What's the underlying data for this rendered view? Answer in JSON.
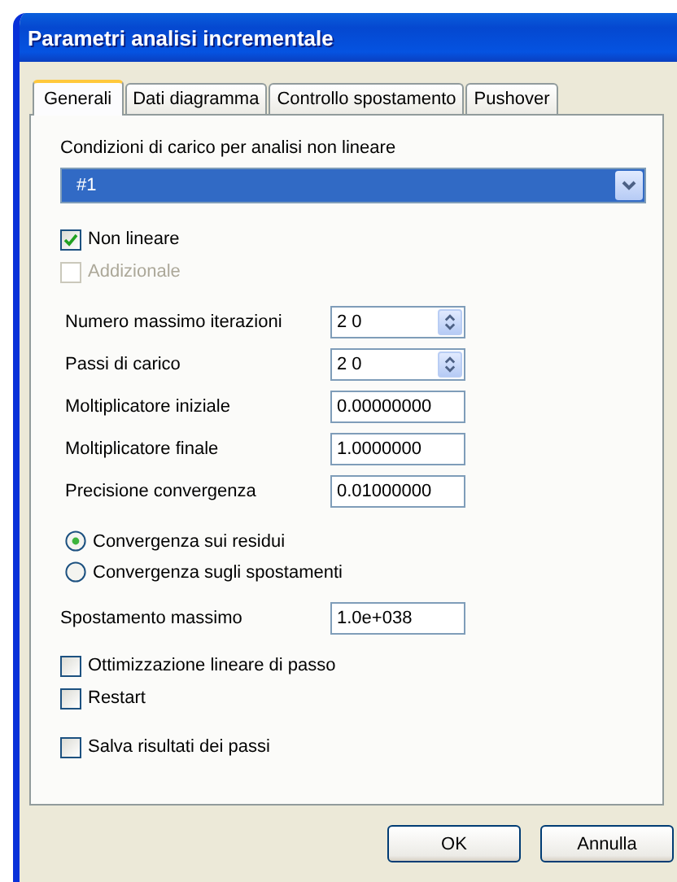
{
  "window": {
    "title": "Parametri analisi incrementale"
  },
  "tabs": [
    {
      "label": "Generali",
      "selected": true
    },
    {
      "label": "Dati diagramma",
      "selected": false
    },
    {
      "label": "Controllo spostamento",
      "selected": false
    },
    {
      "label": "Pushover",
      "selected": false
    }
  ],
  "load_conditions": {
    "label": "Condizioni di carico per analisi non lineare",
    "value": "#1"
  },
  "options_top": [
    {
      "label": "Non lineare",
      "checked": true,
      "disabled": false
    },
    {
      "label": "Addizionale",
      "checked": false,
      "disabled": true
    }
  ],
  "fields": [
    {
      "label": "Numero massimo iterazioni",
      "value": "20",
      "kind": "spin"
    },
    {
      "label": "Passi di carico",
      "value": "20",
      "kind": "spin"
    },
    {
      "label": "Moltiplicatore iniziale",
      "value": "0.00000000",
      "kind": "text"
    },
    {
      "label": "Moltiplicatore finale",
      "value": "1.0000000",
      "kind": "text"
    },
    {
      "label": "Precisione convergenza",
      "value": "0.01000000",
      "kind": "text"
    }
  ],
  "convergence": [
    {
      "label": "Convergenza sui residui",
      "selected": true
    },
    {
      "label": "Convergenza sugli spostamenti",
      "selected": false
    }
  ],
  "max_displacement": {
    "label": "Spostamento massimo",
    "value": "1.0e+038"
  },
  "options_bottom": [
    {
      "label": "Ottimizzazione lineare di passo",
      "checked": false
    },
    {
      "label": "Restart",
      "checked": false
    },
    {
      "label": "Salva risultati dei passi",
      "checked": false
    }
  ],
  "buttons": [
    "OK",
    "Annulla"
  ]
}
